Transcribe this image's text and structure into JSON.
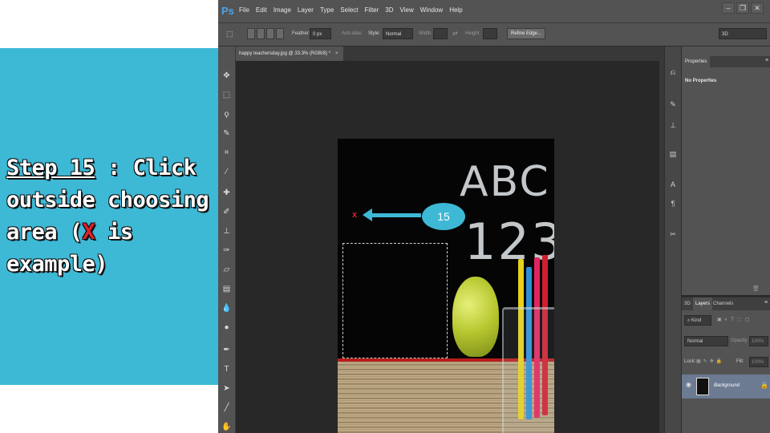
{
  "slide": {
    "step_label": "Step 15",
    "step_rest": " : Click outside choosing area (",
    "x_mark": "X",
    "step_end": " is example)"
  },
  "app": {
    "logo": "Ps",
    "menu": [
      "File",
      "Edit",
      "Image",
      "Layer",
      "Type",
      "Select",
      "Filter",
      "3D",
      "View",
      "Window",
      "Help"
    ],
    "window_controls": [
      "minimize",
      "restore",
      "close"
    ]
  },
  "options_bar": {
    "feather_label": "Feather:",
    "feather_value": "0 px",
    "antialias_label": "Anti-alias",
    "style_label": "Style:",
    "style_value": "Normal",
    "width_label": "Width:",
    "height_label": "Height:",
    "refine_edge": "Refine Edge...",
    "workspace": "3D"
  },
  "document": {
    "tab_title": "happy teachersday.jpg @ 33.3% (RGB/8) *",
    "tab_close": "×",
    "chalk_letters": "ABC",
    "chalk_numbers": "123"
  },
  "annotation": {
    "marker": "x",
    "callout": "15",
    "color": "#3db8d5"
  },
  "properties_panel": {
    "tab": "Properties",
    "content": "No Properties"
  },
  "layers_panel": {
    "tabs": [
      "3D",
      "Layers",
      "Channels"
    ],
    "kind_label": "Kind",
    "blend_mode": "Normal",
    "opacity_label": "Opacity:",
    "opacity_value": "100%",
    "lock_label": "Lock:",
    "fill_label": "Fill:",
    "fill_value": "100%",
    "layer_name": "Background"
  },
  "colors": {
    "slide_bg": "#3db8d5",
    "ps_dark": "#282828",
    "ps_panel": "#535353",
    "accent_red": "#e0202a"
  }
}
